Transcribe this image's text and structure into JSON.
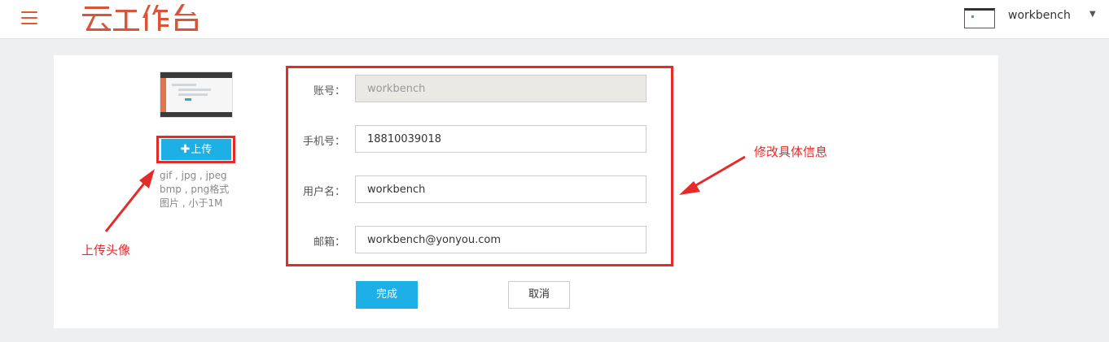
{
  "header": {
    "logo_text": "云工作台",
    "brand_color": "#e05a2b",
    "menu_icon": "hamburger-menu-icon",
    "user": {
      "name": "workbench",
      "avatar_icon": "avatar-thumbnail",
      "dropdown_icon": "caret-down-icon"
    }
  },
  "upload": {
    "button_label": "上传",
    "button_icon": "plus-icon",
    "hint_lines": [
      "gif , jpg , jpeg",
      "bmp , png格式",
      "图片 , 小于1M"
    ]
  },
  "form": {
    "fields": [
      {
        "label": "账号：",
        "value": "workbench",
        "disabled": true
      },
      {
        "label": "手机号：",
        "value": "18810039018",
        "disabled": false
      },
      {
        "label": "用户名：",
        "value": "workbench",
        "disabled": false
      },
      {
        "label": "邮箱：",
        "value": "workbench@yonyou.com",
        "disabled": false
      }
    ]
  },
  "actions": {
    "done_label": "完成",
    "cancel_label": "取消"
  },
  "annotations": {
    "upload_note": "上传头像",
    "edit_note": "修改具体信息"
  },
  "colors": {
    "accent": "#1db0e6",
    "highlight": "#e52a2a",
    "page_bg": "#eeeff1"
  }
}
